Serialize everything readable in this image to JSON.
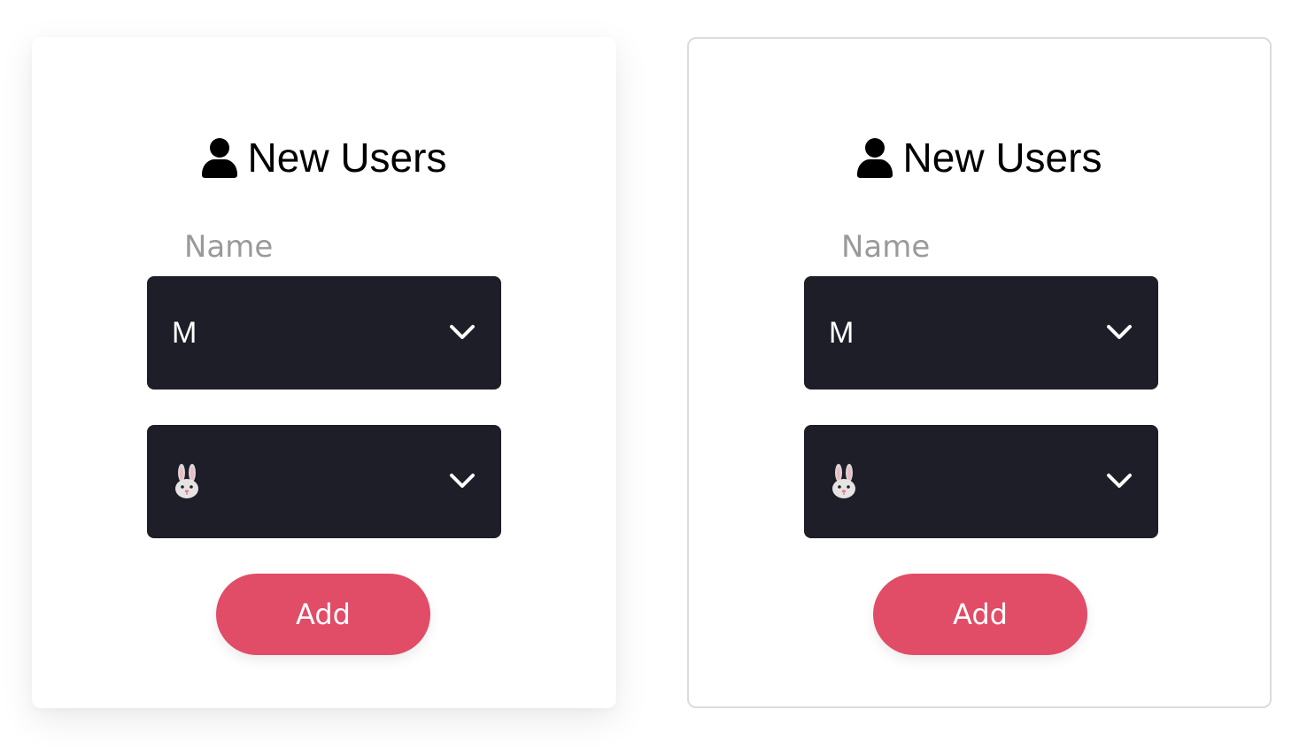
{
  "cards": [
    {
      "title": "New Users",
      "name_placeholder": "Name",
      "size_select": {
        "value": "M"
      },
      "animal_select": {
        "value": "🐰",
        "icon": "rabbit-emoji"
      },
      "add_label": "Add"
    },
    {
      "title": "New Users",
      "name_placeholder": "Name",
      "size_select": {
        "value": "M"
      },
      "animal_select": {
        "value": "🐰",
        "icon": "rabbit-emoji"
      },
      "add_label": "Add"
    }
  ],
  "colors": {
    "select_bg": "#1e1e28",
    "button_bg": "#e14c67",
    "text": "#000000",
    "placeholder": "#9a9a9a"
  },
  "icons": {
    "title_icon": "user-icon",
    "chevron": "chevron-down-icon"
  }
}
